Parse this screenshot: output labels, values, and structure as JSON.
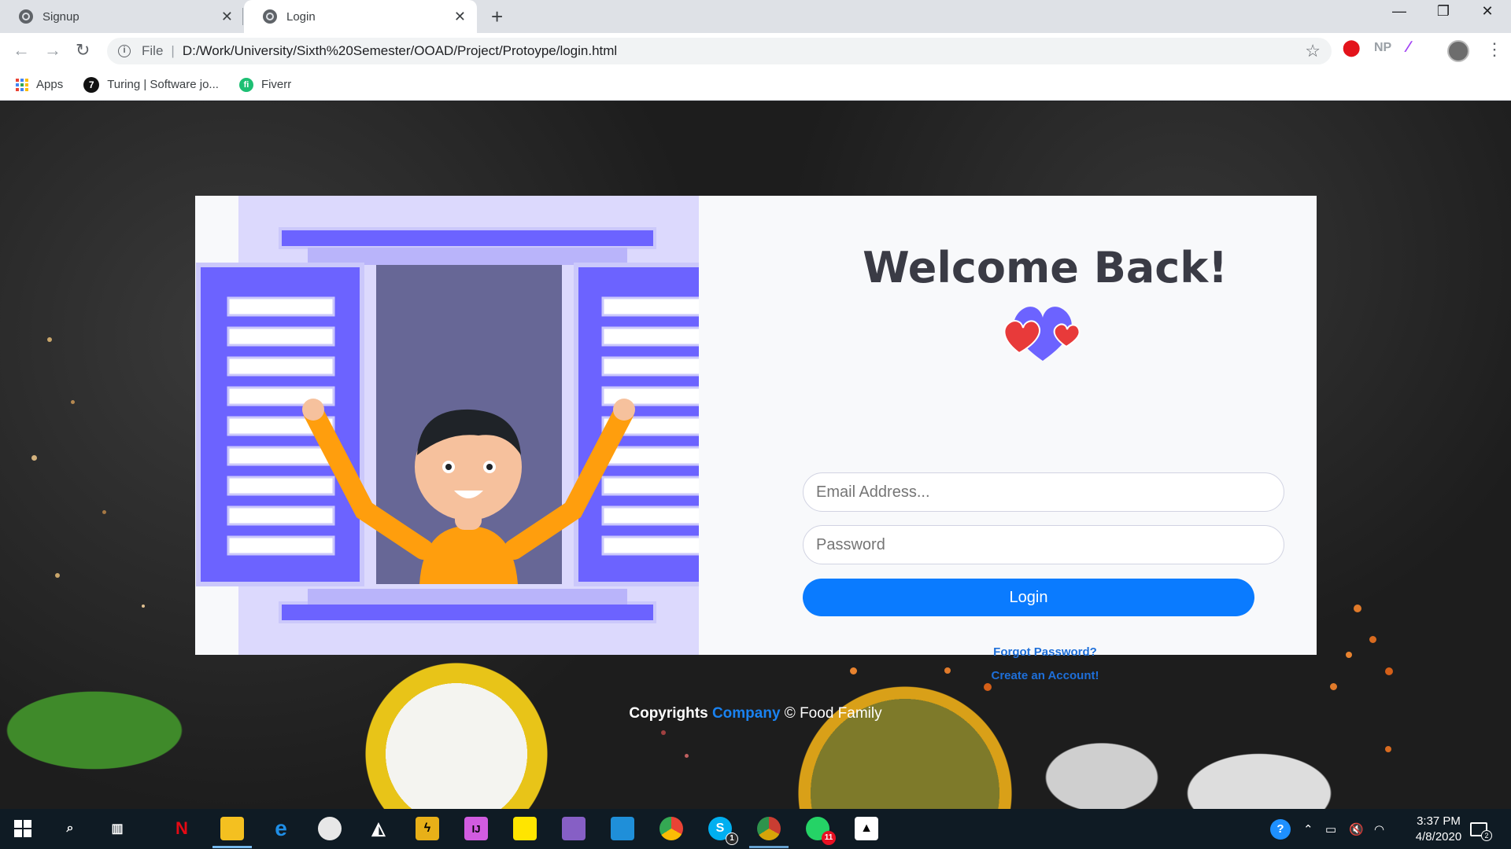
{
  "browser": {
    "tabs": [
      {
        "title": "Signup",
        "active": false
      },
      {
        "title": "Login",
        "active": true
      }
    ],
    "new_tab_symbol": "+",
    "window_controls": {
      "minimize": "—",
      "restore": "❐",
      "close": "✕"
    },
    "address": {
      "scheme_label": "File",
      "url": "D:/Work/University/Sixth%20Semester/OOAD/Project/Protoype/login.html"
    },
    "extensions": [
      "NP"
    ],
    "bookmarks": [
      {
        "label": "Apps",
        "icon": "apps-grid-icon"
      },
      {
        "label": "Turing | Software jo...",
        "icon": "turing-icon"
      },
      {
        "label": "Fiverr",
        "icon": "fiverr-icon"
      }
    ]
  },
  "page": {
    "heading": "Welcome Back!",
    "email_placeholder": "Email Address...",
    "password_placeholder": "Password",
    "login_label": "Login",
    "forgot_link": "Forgot Password?",
    "create_link": "Create an Account!",
    "footer": {
      "prefix": "Copyrights",
      "brand": "Company",
      "suffix": "© Food Family"
    },
    "colors": {
      "primary": "#0a7bff",
      "illustration_purple": "#6c63ff",
      "link": "#1e6fd9"
    }
  },
  "taskbar": {
    "apps": [
      "windows-start",
      "search",
      "task-view",
      "netflix",
      "file-explorer",
      "edge",
      "paint",
      "unity",
      "gamemaker",
      "jetbrains",
      "sticky-notes",
      "visual-studio",
      "vscode",
      "chrome",
      "skype",
      "chrome-canary",
      "whatsapp",
      "photos"
    ],
    "skype_badge": "1",
    "whatsapp_badge": "11",
    "notification_count": "2",
    "time": "3:37 PM",
    "date": "4/8/2020"
  }
}
